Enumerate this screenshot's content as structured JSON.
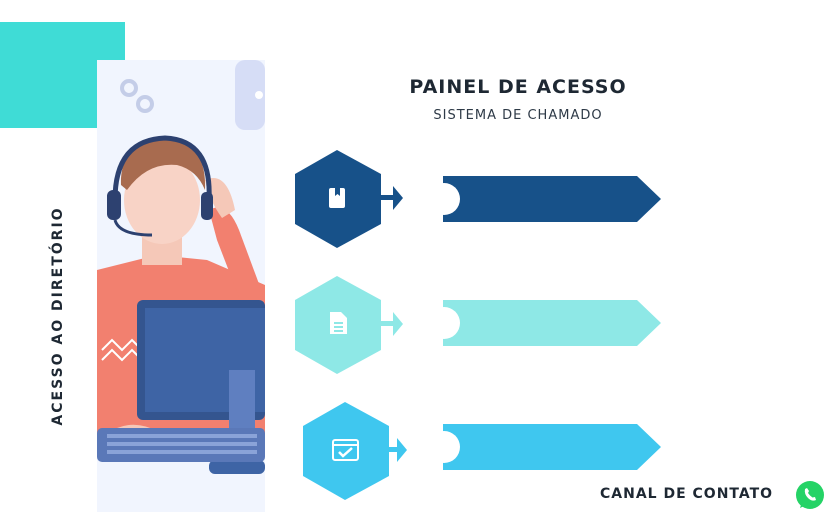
{
  "header": {
    "title": "PAINEL DE ACESSO",
    "subtitle": "SISTEMA DE CHAMADO"
  },
  "sidebar": {
    "label": "ACESSO AO DIRETÓRIO"
  },
  "rows": [
    {
      "icon": "bookmark-document-icon",
      "color": "#175189",
      "bar_color": "#175189"
    },
    {
      "icon": "document-icon",
      "color": "#8ee8e6",
      "bar_color": "#8ee8e6"
    },
    {
      "icon": "checked-window-icon",
      "color": "#3fc7ef",
      "bar_color": "#3fc7ef"
    }
  ],
  "footer": {
    "contact_label": "CANAL DE CONTATO",
    "contact_icon": "whatsapp-icon"
  },
  "colors": {
    "accent_teal": "#3fdcd6",
    "text_dark": "#1e2833"
  }
}
